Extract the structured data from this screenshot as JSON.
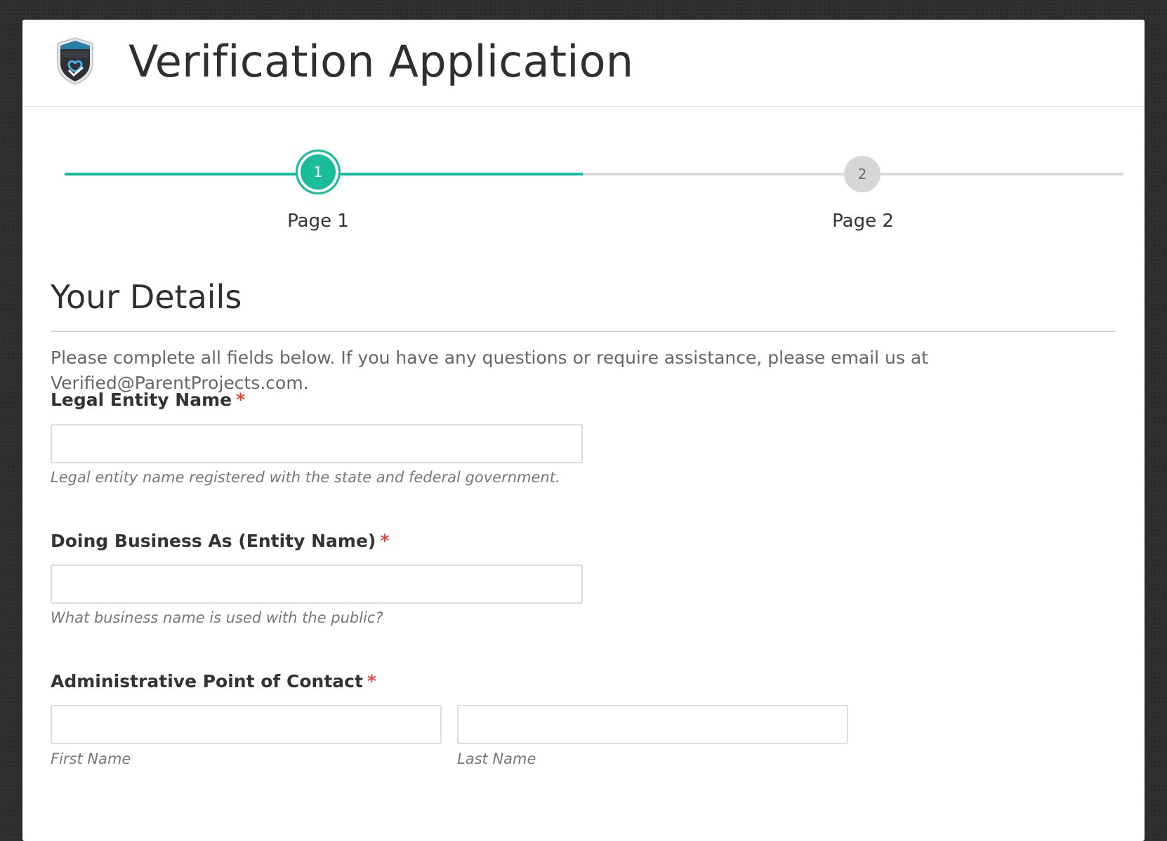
{
  "header": {
    "title": "Verification Application",
    "logo_icon": "verified-shield-logo"
  },
  "progress": {
    "percent_complete": 50,
    "steps": [
      {
        "number": "1",
        "label": "Page 1",
        "state": "active"
      },
      {
        "number": "2",
        "label": "Page 2",
        "state": "upcoming"
      }
    ],
    "accent_color": "#1abc9c"
  },
  "section": {
    "title": "Your Details",
    "intro": "Please complete all fields below. If you have any questions or require assistance, please email us at Verified@ParentProjects.com."
  },
  "fields": {
    "legal_entity": {
      "label": "Legal Entity Name",
      "required_mark": "*",
      "value": "",
      "hint": "Legal entity name registered with the state and federal government."
    },
    "dba": {
      "label": "Doing Business As (Entity Name)",
      "required_mark": "*",
      "value": "",
      "hint": "What business name is used with the public?"
    },
    "admin_contact": {
      "label": "Administrative Point of Contact",
      "required_mark": "*",
      "first_name_value": "",
      "first_name_hint": "First Name",
      "last_name_value": "",
      "last_name_hint": "Last Name"
    }
  }
}
